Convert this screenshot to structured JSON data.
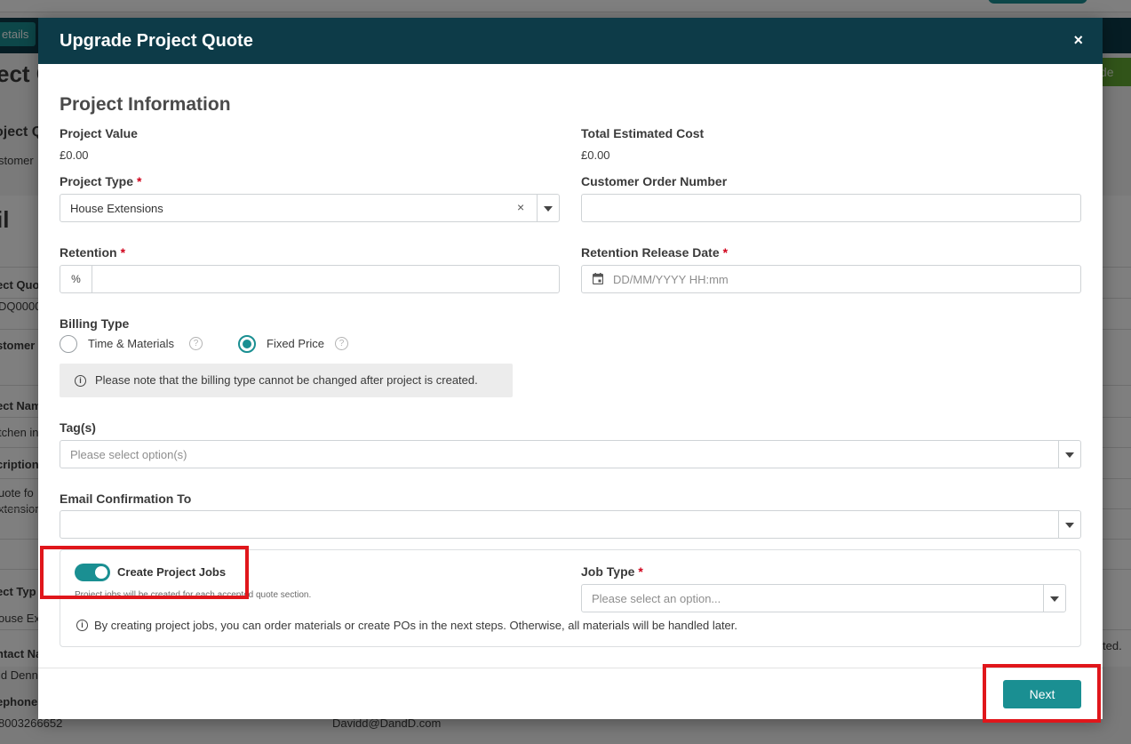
{
  "background": {
    "tab_label": "etails",
    "page_heading": "ect Q",
    "upgrade_button": "de",
    "labels": [
      "oject Q",
      "stomer",
      "il",
      "ect Quo",
      "DQ0000",
      "stomer C",
      "ect Nam",
      "tchen in",
      "cription",
      "uote fo",
      "xtensior",
      "ect Typ",
      "ouse Ext",
      "ntact Na",
      "id Denn",
      "ephone",
      "8003266652",
      "Davidd@DandD.com",
      "ted."
    ]
  },
  "modal": {
    "title": "Upgrade Project Quote",
    "close_label": "×",
    "section_title": "Project Information",
    "project_value": {
      "label": "Project Value",
      "value": "£0.00"
    },
    "total_estimated_cost": {
      "label": "Total Estimated Cost",
      "value": "£0.00"
    },
    "project_type": {
      "label": "Project Type",
      "required_mark": "*",
      "value": "House Extensions",
      "clear_label": "×"
    },
    "customer_order_number": {
      "label": "Customer Order Number",
      "value": ""
    },
    "retention": {
      "label": "Retention",
      "required_mark": "*",
      "addon": "%",
      "value": ""
    },
    "retention_release_date": {
      "label": "Retention Release Date",
      "required_mark": "*",
      "placeholder": "DD/MM/YYYY HH:mm"
    },
    "billing_type": {
      "label": "Billing Type",
      "options": [
        {
          "label": "Time & Materials",
          "selected": false
        },
        {
          "label": "Fixed Price",
          "selected": true
        }
      ],
      "note": "Please note that the billing type cannot be changed after project is created."
    },
    "tags": {
      "label": "Tag(s)",
      "placeholder": "Please select option(s)"
    },
    "email_confirmation": {
      "label": "Email Confirmation To",
      "value": ""
    },
    "project_jobs": {
      "toggle_label": "Create Project Jobs",
      "toggle_on": true,
      "sub_note": "Project jobs will be created for each accepted quote section.",
      "info": "By creating project jobs, you can order materials or create POs in the next steps. Otherwise, all materials will be handled later."
    },
    "job_type": {
      "label": "Job Type",
      "required_mark": "*",
      "placeholder": "Please select an option..."
    },
    "next_label": "Next"
  },
  "colors": {
    "header": "#0d3b48",
    "accent": "#1a8f92",
    "required": "#d0021b",
    "highlight": "#e0161b"
  }
}
